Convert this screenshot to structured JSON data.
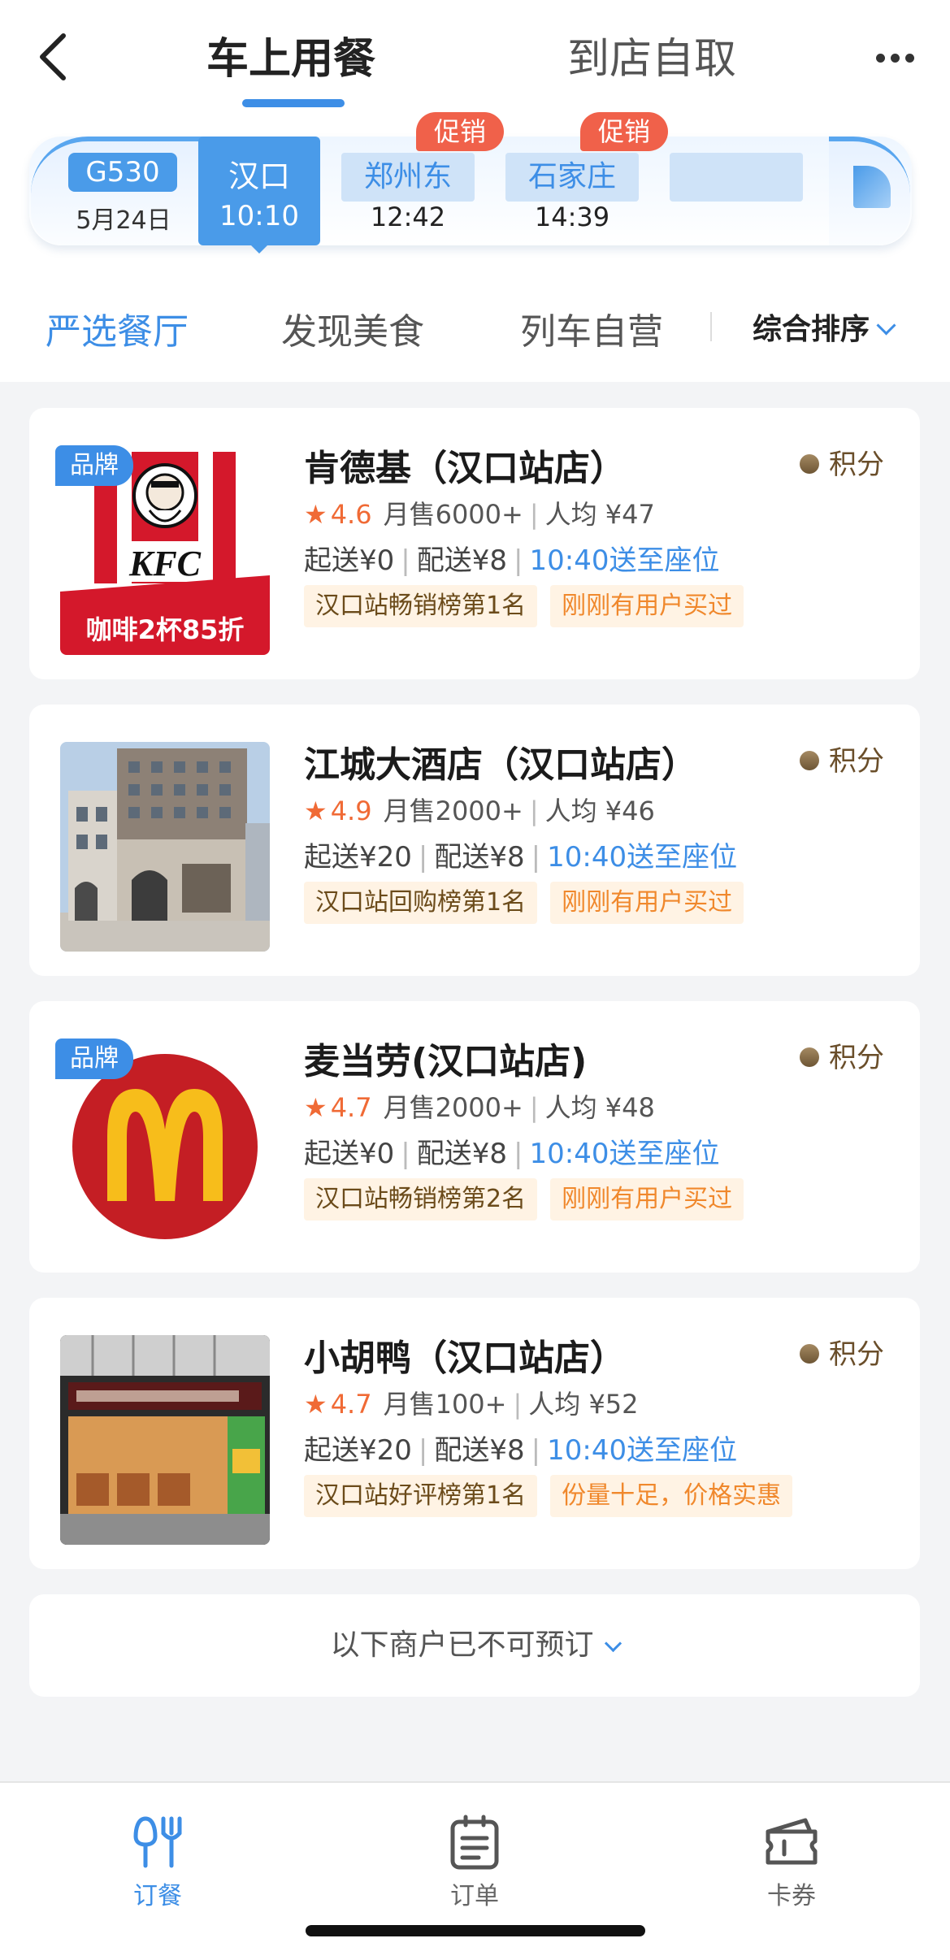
{
  "header": {
    "tabs": [
      {
        "label": "车上用餐",
        "active": true
      },
      {
        "label": "到店自取",
        "active": false
      }
    ]
  },
  "train": {
    "code": "G530",
    "date": "5月24日",
    "stations": [
      {
        "name": "汉口",
        "time": "10:10",
        "selected": true,
        "promo": ""
      },
      {
        "name": "郑州东",
        "time": "12:42",
        "selected": false,
        "promo": "促销"
      },
      {
        "name": "石家庄",
        "time": "14:39",
        "selected": false,
        "promo": "促销"
      },
      {
        "name": "",
        "time": "",
        "selected": false,
        "promo": ""
      }
    ]
  },
  "filters": {
    "items": [
      {
        "label": "严选餐厅",
        "active": true
      },
      {
        "label": "发现美食",
        "active": false
      },
      {
        "label": "列车自营",
        "active": false
      }
    ],
    "sort_label": "综合排序"
  },
  "restaurants": [
    {
      "name": "肯德基（汉口站店）",
      "brand_tag": "品牌",
      "points_label": "积分",
      "rating": "4.6",
      "monthly_sales": "月售6000+",
      "avg_price": "人均 ¥47",
      "min_order": "起送¥0",
      "delivery_fee": "配送¥8",
      "delivery_time": "10:40送至座位",
      "chips": [
        "汉口站畅销榜第1名",
        "刚刚有用户买过"
      ],
      "logo_text": "KFC",
      "promo_banner": "咖啡2杯85折"
    },
    {
      "name": "江城大酒店（汉口站店）",
      "brand_tag": "",
      "points_label": "积分",
      "rating": "4.9",
      "monthly_sales": "月售2000+",
      "avg_price": "人均 ¥46",
      "min_order": "起送¥20",
      "delivery_fee": "配送¥8",
      "delivery_time": "10:40送至座位",
      "chips": [
        "汉口站回购榜第1名",
        "刚刚有用户买过"
      ]
    },
    {
      "name": "麦当劳(汉口站店)",
      "brand_tag": "品牌",
      "points_label": "积分",
      "rating": "4.7",
      "monthly_sales": "月售2000+",
      "avg_price": "人均 ¥48",
      "min_order": "起送¥0",
      "delivery_fee": "配送¥8",
      "delivery_time": "10:40送至座位",
      "chips": [
        "汉口站畅销榜第2名",
        "刚刚有用户买过"
      ]
    },
    {
      "name": "小胡鸭（汉口站店）",
      "brand_tag": "",
      "points_label": "积分",
      "rating": "4.7",
      "monthly_sales": "月售100+",
      "avg_price": "人均 ¥52",
      "min_order": "起送¥20",
      "delivery_fee": "配送¥8",
      "delivery_time": "10:40送至座位",
      "chips": [
        "汉口站好评榜第1名",
        "份量十足，价格实惠"
      ]
    }
  ],
  "closed_notice": "以下商户已不可预订",
  "bottom_nav": [
    {
      "label": "订餐",
      "icon": "fork-knife-icon",
      "active": true
    },
    {
      "label": "订单",
      "icon": "clipboard-icon",
      "active": false
    },
    {
      "label": "卡券",
      "icon": "ticket-icon",
      "active": false
    }
  ],
  "colors": {
    "accent": "#3d8ee6",
    "promo": "#f0614a",
    "rating": "#f06a35",
    "chip_bg": "#fff3e4",
    "chip_hint": "#f0882c"
  }
}
